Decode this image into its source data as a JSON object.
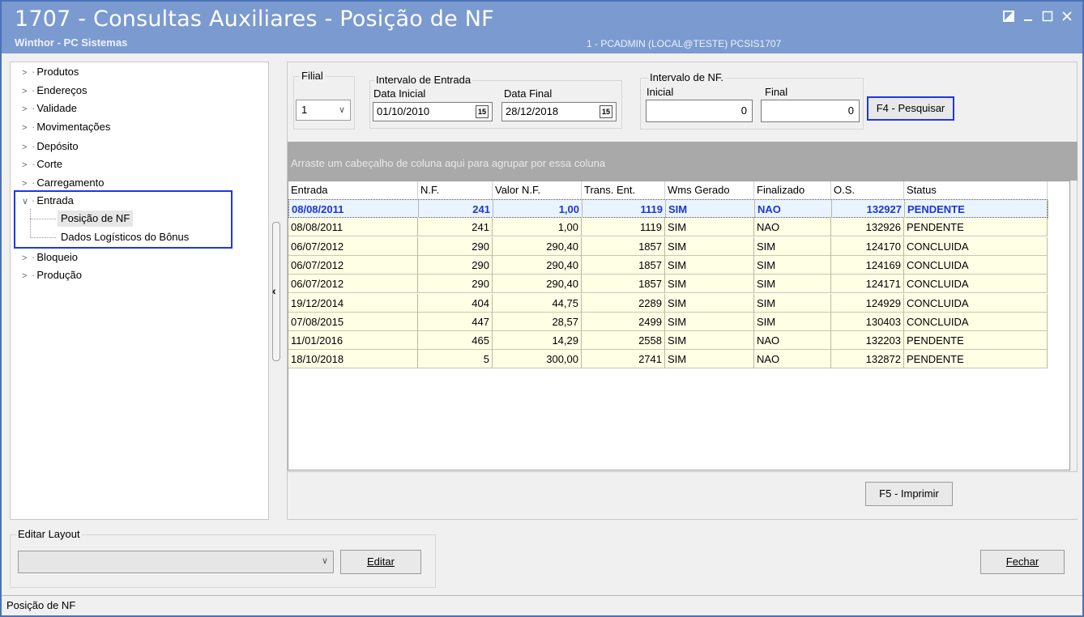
{
  "window": {
    "title": "1707 - Consultas Auxiliares - Posição de NF",
    "subtitle": "Winthor - PC Sistemas",
    "userinfo": "1 - PCADMIN (LOCAL@TESTE)   PCSIS1707"
  },
  "tree": {
    "items": [
      {
        "label": "Produtos"
      },
      {
        "label": "Endereços"
      },
      {
        "label": "Validade"
      },
      {
        "label": "Movimentações"
      },
      {
        "label": "Depósito"
      },
      {
        "label": "Corte"
      },
      {
        "label": "Carregamento"
      },
      {
        "label": "Entrada"
      },
      {
        "label": "Bloqueio"
      },
      {
        "label": "Produção"
      }
    ],
    "sub_items": [
      {
        "label": "Posição de NF"
      },
      {
        "label": "Dados Logísticos do Bônus"
      }
    ]
  },
  "filters": {
    "filial_label": "Filial",
    "filial_value": "1",
    "intervalo_entrada_label": "Intervalo de Entrada",
    "data_inicial_label": "Data Inicial",
    "data_inicial_value": "01/10/2010",
    "data_final_label": "Data Final",
    "data_final_value": "28/12/2018",
    "intervalo_nf_label": "Intervalo de NF.",
    "inicial_label": "Inicial",
    "inicial_value": "0",
    "final_label": "Final",
    "final_value": "0",
    "calendar_glyph": "15",
    "pesquisar_label": "F4 - Pesquisar"
  },
  "grid": {
    "group_hint": "Arraste um cabeçalho de coluna aqui para agrupar por essa coluna",
    "columns": [
      "Entrada",
      "N.F.",
      "Valor N.F.",
      "Trans. Ent.",
      "Wms Gerado",
      "Finalizado",
      "O.S.",
      "Status"
    ],
    "rows": [
      [
        "08/08/2011",
        "241",
        "1,00",
        "1119",
        "SIM",
        "NAO",
        "132927",
        "PENDENTE"
      ],
      [
        "08/08/2011",
        "241",
        "1,00",
        "1119",
        "SIM",
        "NAO",
        "132926",
        "PENDENTE"
      ],
      [
        "06/07/2012",
        "290",
        "290,40",
        "1857",
        "SIM",
        "SIM",
        "124170",
        "CONCLUIDA"
      ],
      [
        "06/07/2012",
        "290",
        "290,40",
        "1857",
        "SIM",
        "SIM",
        "124169",
        "CONCLUIDA"
      ],
      [
        "06/07/2012",
        "290",
        "290,40",
        "1857",
        "SIM",
        "SIM",
        "124171",
        "CONCLUIDA"
      ],
      [
        "19/12/2014",
        "404",
        "44,75",
        "2289",
        "SIM",
        "SIM",
        "124929",
        "CONCLUIDA"
      ],
      [
        "07/08/2015",
        "447",
        "28,57",
        "2499",
        "SIM",
        "SIM",
        "130403",
        "CONCLUIDA"
      ],
      [
        "11/01/2016",
        "465",
        "14,29",
        "2558",
        "SIM",
        "NAO",
        "132203",
        "PENDENTE"
      ],
      [
        "18/10/2018",
        "5",
        "300,00",
        "2741",
        "SIM",
        "NAO",
        "132872",
        "PENDENTE"
      ]
    ],
    "imprimir_label": "F5 - Imprimir"
  },
  "layout_editor": {
    "label": "Editar Layout",
    "select_value": "",
    "editar_label": "Editar",
    "fechar_label": "Fechar"
  },
  "statusbar": {
    "text": "Posição de NF"
  }
}
